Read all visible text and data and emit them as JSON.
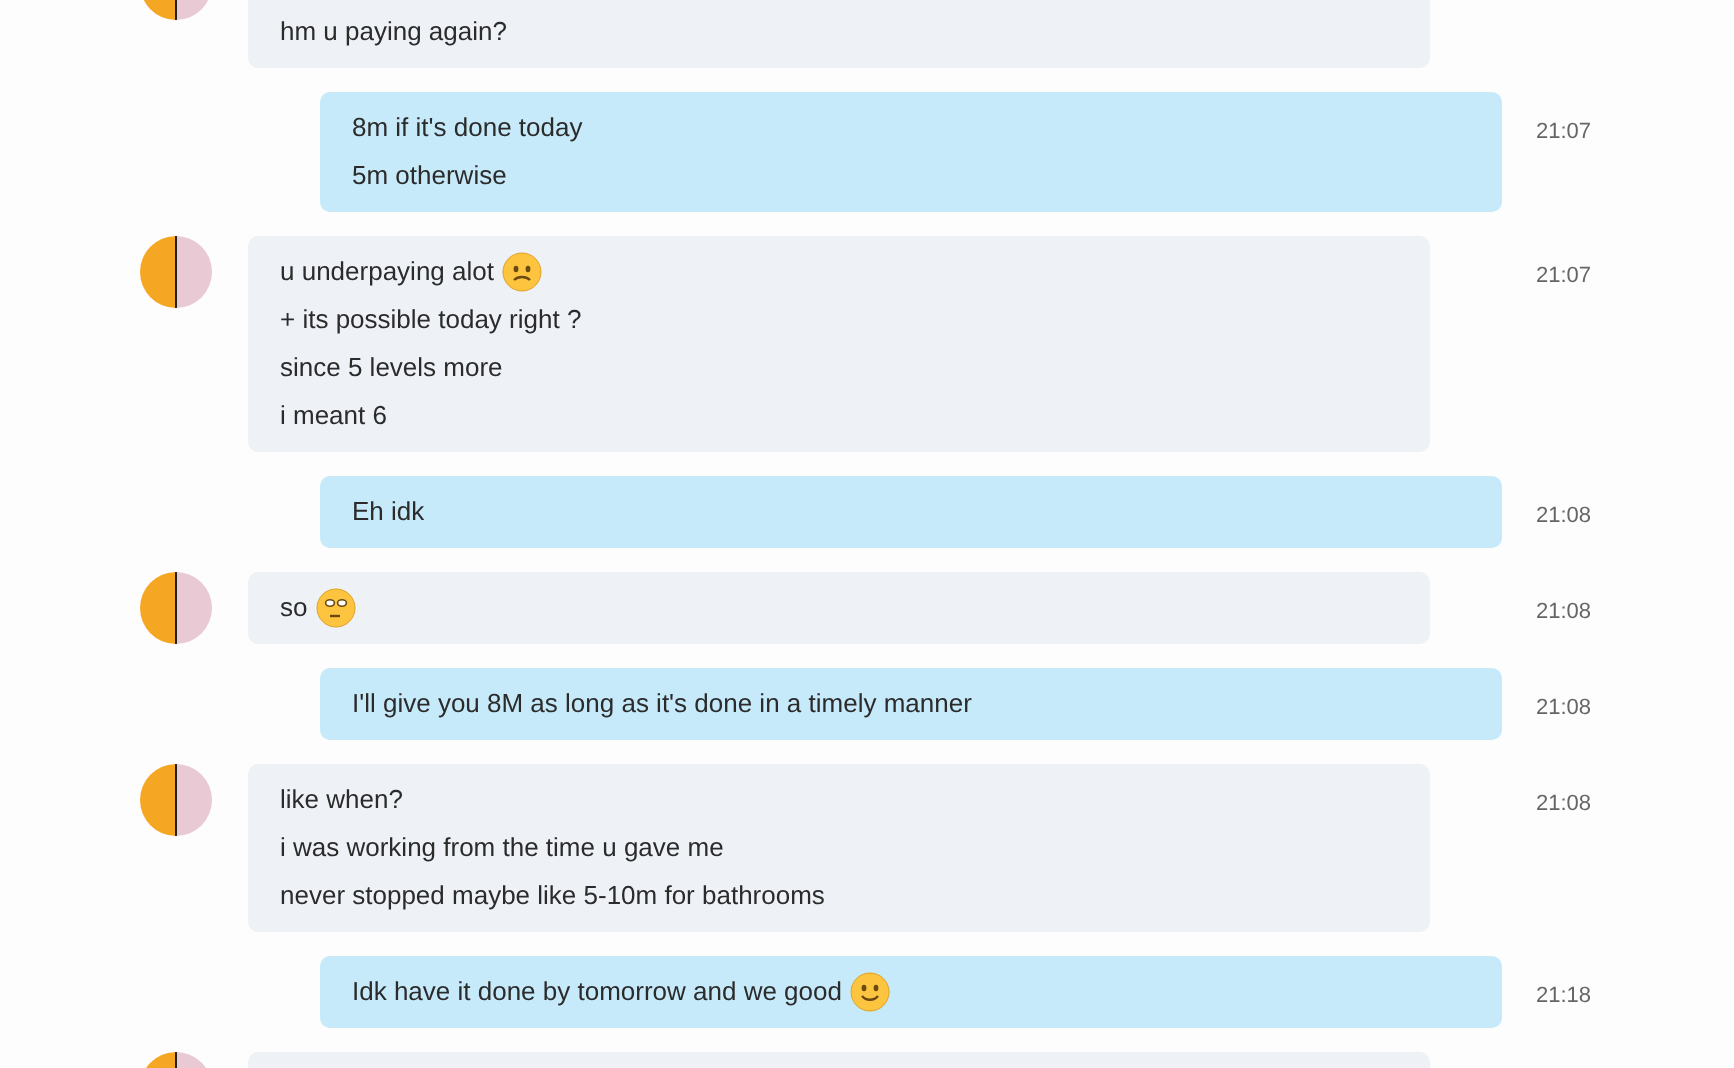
{
  "messages": [
    {
      "kind": "incoming",
      "lines": [
        {
          "text": "hm u paying again?"
        }
      ]
    },
    {
      "kind": "outgoing",
      "time": "21:07",
      "lines": [
        {
          "text": "8m if it's done today"
        },
        {
          "text": "5m otherwise"
        }
      ]
    },
    {
      "kind": "incoming",
      "time": "21:07",
      "lines": [
        {
          "text": "u underpaying alot",
          "emoji": {
            "kind": "sad"
          }
        },
        {
          "text": "+ its possible today right ?"
        },
        {
          "text": "since 5 levels more"
        },
        {
          "text": "i meant 6"
        }
      ]
    },
    {
      "kind": "outgoing",
      "time": "21:08",
      "lines": [
        {
          "text": "Eh idk"
        }
      ]
    },
    {
      "kind": "incoming",
      "time": "21:08",
      "lines": [
        {
          "text": "so",
          "emoji": {
            "kind": "eyeroll"
          }
        }
      ]
    },
    {
      "kind": "outgoing",
      "time": "21:08",
      "lines": [
        {
          "text": "I'll give you 8M as long as it's done in a timely manner"
        }
      ]
    },
    {
      "kind": "incoming",
      "time": "21:08",
      "lines": [
        {
          "text": "like when?"
        },
        {
          "text": "i was working from the time u gave me"
        },
        {
          "text": "never stopped maybe like 5-10m for bathrooms"
        }
      ]
    },
    {
      "kind": "outgoing",
      "time": "21:18",
      "lines": [
        {
          "text": "Idk have it done by tomorrow and we good",
          "emoji": {
            "kind": "smile"
          }
        }
      ]
    },
    {
      "kind": "incoming"
    }
  ]
}
